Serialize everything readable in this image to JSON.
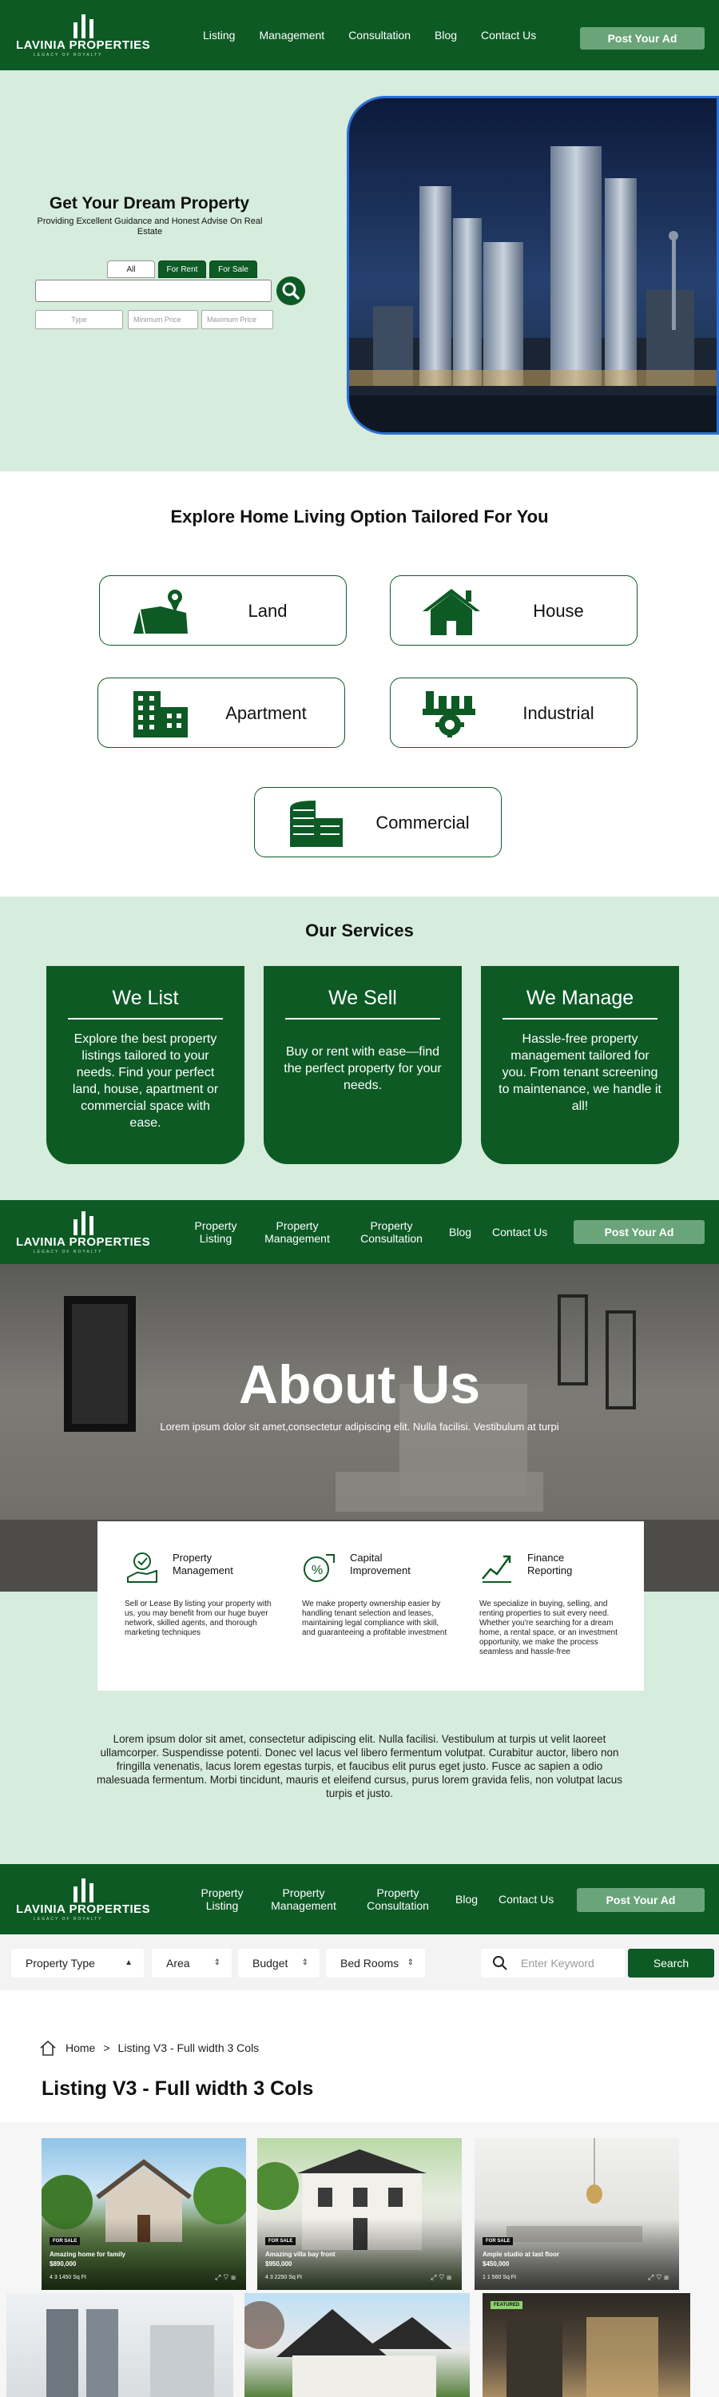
{
  "brand": {
    "name": "LAVINIA PROPERTIES",
    "tagline": "LEGACY OF ROYALTY"
  },
  "colors": {
    "primary": "#0d5a25",
    "accent": "#6aa57a",
    "mint": "#d6ecdc"
  },
  "nav1": {
    "links": [
      "Listing",
      "Management",
      "Consultation",
      "Blog",
      "Contact Us"
    ],
    "post_ad": "Post Your Ad"
  },
  "nav2": {
    "links": [
      "Property Listing",
      "Property Management",
      "Property Consultation",
      "Blog",
      "Contact Us"
    ],
    "post_ad": "Post Your Ad"
  },
  "hero": {
    "title": "Get Your Dream Property",
    "subtitle": "Providing Excellent Guidance and Honest Advise On Real Estate",
    "tabs": [
      "All",
      "For Rent",
      "For Sale"
    ],
    "active_tabs": [
      "For Rent",
      "For Sale"
    ],
    "search_value": "",
    "type_placeholder": "Type",
    "min_price_placeholder": "Minimum Price",
    "max_price_placeholder": "Maximum Price",
    "search_icon": "search-icon"
  },
  "explore": {
    "title": "Explore Home Living Option Tailored For You",
    "categories": [
      {
        "label": "Land",
        "icon": "land-map-icon"
      },
      {
        "label": "House",
        "icon": "house-icon"
      },
      {
        "label": "Apartment",
        "icon": "apartment-icon"
      },
      {
        "label": "Industrial",
        "icon": "industrial-gear-icon"
      },
      {
        "label": "Commercial",
        "icon": "commercial-building-icon"
      }
    ]
  },
  "services": {
    "title": "Our Services",
    "cards": [
      {
        "title": "We List",
        "text": "Explore the best property listings tailored to your needs. Find your perfect land, house, apartment or commercial space with ease."
      },
      {
        "title": "We Sell",
        "text": "Buy or rent with ease—find the perfect property for your needs."
      },
      {
        "title": "We Manage",
        "text": "Hassle-free property management tailored for you. From tenant screening to maintenance, we handle it all!"
      }
    ]
  },
  "about": {
    "title": "About Us",
    "subtitle": "Lorem ipsum dolor sit amet,consectetur adipiscing elit. Nulla facilisi. Vestibulum at turpi",
    "features": [
      {
        "title": "Property Management",
        "icon": "property-management-icon",
        "text": "Sell or Lease By listing your property with us, you may benefit from our huge buyer network, skilled agents, and thorough marketing techniques"
      },
      {
        "title": "Capital Improvement",
        "icon": "capital-improvement-icon",
        "text": "We make property ownership easier by handling tenant selection and leases, maintaining legal compliance with skill, and guaranteeing a profitable investment"
      },
      {
        "title": "Finance Reporting",
        "icon": "finance-reporting-icon",
        "text": "We specialize in buying, selling, and renting properties to suit every need. Whether you're searching for a dream home, a rental space, or an investment opportunity, we make the process seamless and hassle-free"
      }
    ],
    "paragraph": "Lorem ipsum dolor sit amet, consectetur adipiscing elit. Nulla facilisi. Vestibulum at turpis ut velit laoreet ullamcorper. Suspendisse potenti. Donec vel lacus vel libero fermentum volutpat. Curabitur auctor, libero non fringilla venenatis, lacus lorem egestas turpis, et faucibus elit purus eget justo. Fusce ac sapien a odio malesuada fermentum. Morbi tincidunt, mauris et eleifend cursus, purus lorem gravida felis, non volutpat lacus turpis et justo."
  },
  "filters": {
    "selects": [
      "Property Type",
      "Area",
      "Budget",
      "Bed Rooms"
    ],
    "keyword_placeholder": "Enter Keyword",
    "search_label": "Search"
  },
  "breadcrumb": {
    "home": "Home",
    "separator": ">",
    "current": "Listing V3 - Full width 3 Cols"
  },
  "listing": {
    "title": "Listing V3 - Full width 3 Cols",
    "cards": [
      {
        "badge": "FOR SALE",
        "name": "Amazing home for family",
        "price": "$890,000",
        "meta": "4  3  1450 Sq Ft"
      },
      {
        "badge": "FOR SALE",
        "name": "Amazing villa bay front",
        "price": "$950,000",
        "meta": "4  3  2250 Sq Ft"
      },
      {
        "badge": "FOR SALE",
        "name": "Ample studio at last floor",
        "price": "$450,000",
        "meta": "1  1  560 Sq Ft"
      },
      {
        "badge": "",
        "name": "",
        "price": "",
        "meta": ""
      },
      {
        "badge": "",
        "name": "",
        "price": "",
        "meta": ""
      },
      {
        "badge": "FEATURED",
        "name": "",
        "price": "",
        "meta": ""
      }
    ]
  }
}
